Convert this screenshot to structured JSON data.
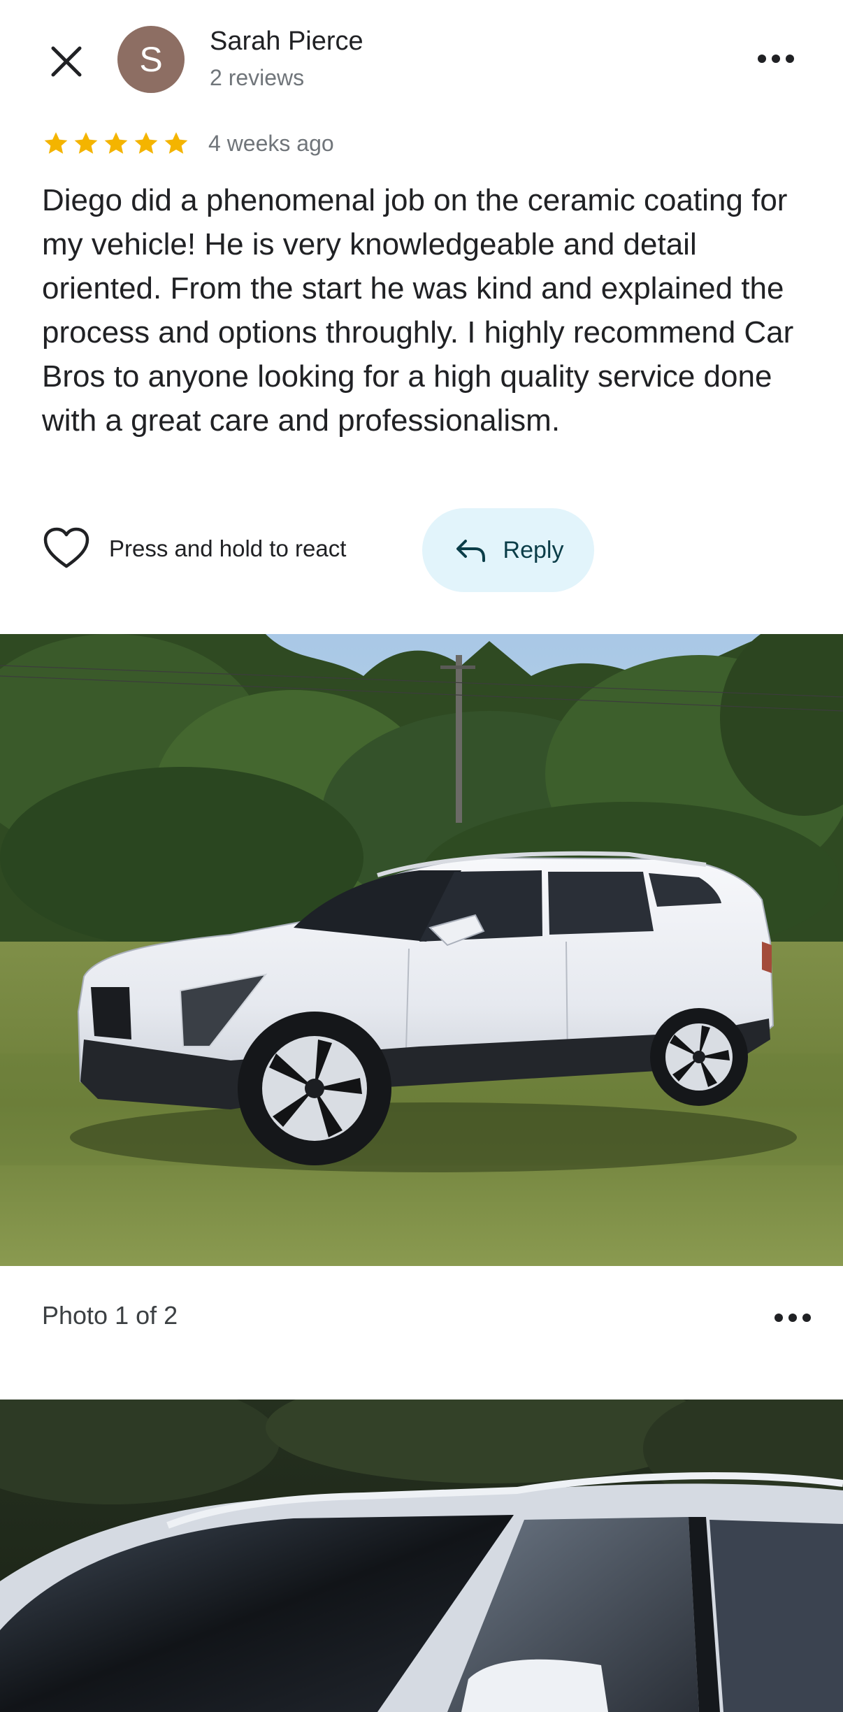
{
  "reviewer": {
    "initial": "S",
    "name": "Sarah Pierce",
    "review_count": "2 reviews",
    "avatar_color": "#8d6e63"
  },
  "review": {
    "rating": 5,
    "max_rating": 5,
    "time_ago": "4 weeks ago",
    "text": "Diego did a phenomenal job on the ceramic coating for my vehicle! He is very knowledgeable and detail oriented. From the start he was kind and explained the process and options throughly. I highly recommend Car Bros to anyone looking for a high quality service done with a great care and professionalism."
  },
  "actions": {
    "react_label": "Press and hold to react",
    "reply_label": "Reply"
  },
  "photos": {
    "caption": "Photo 1 of 2"
  },
  "colors": {
    "star": "#f4b400",
    "reply_bg": "#e2f4fb",
    "secondary_text": "#70757a"
  },
  "icons": [
    "close-icon",
    "more-vert-icon",
    "star-icon",
    "heart-outline-icon",
    "reply-arrow-icon"
  ]
}
